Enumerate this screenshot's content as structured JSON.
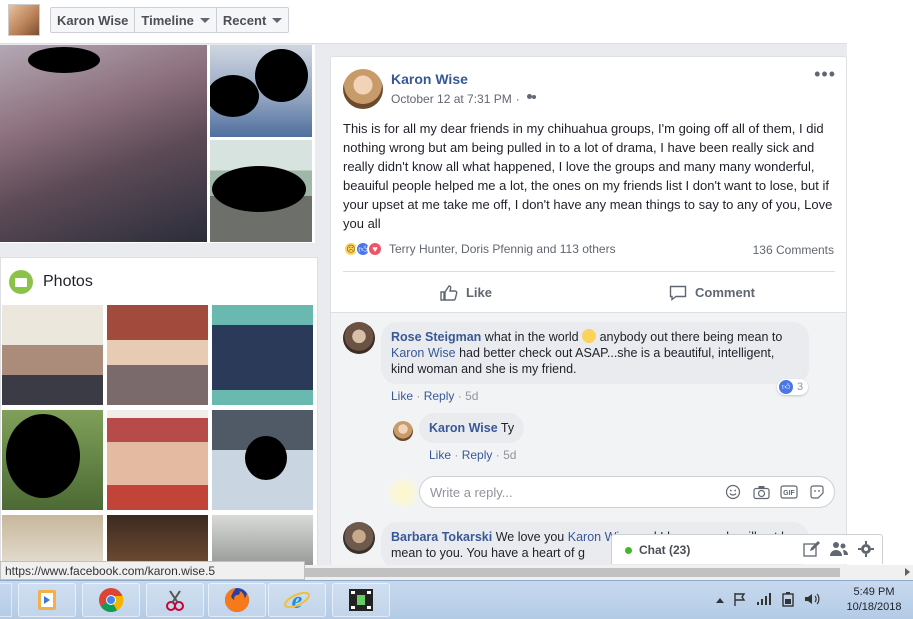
{
  "header": {
    "profile_name": "Karon Wise",
    "timeline_label": "Timeline",
    "recent_label": "Recent"
  },
  "photos": {
    "title": "Photos"
  },
  "post": {
    "author": "Karon Wise",
    "date": "October 12 at 7:31 PM",
    "separator": "·",
    "audience_icon": "friends-icon",
    "text": "This is for all my dear friends in my chihuahua groups, I'm going off all of them, I did nothing wrong but am being pulled in to a lot of drama, I have been really sick and really didn't know all what happened, I love the groups and many many wonderful, beauiful people helped me a lot, the ones on my friends list I don't want to lose, but if your upset at me take me off, I don't have any mean things to say to any of you, Love you all",
    "reactors": "Terry Hunter, Doris Pfennig and 113 others",
    "comments_count": "136 Comments",
    "like_label": "Like",
    "comment_label": "Comment"
  },
  "comments": [
    {
      "name": "Rose Steigman",
      "text_before": "what in the world",
      "text_after": "anybody out there being mean to",
      "mention": "Karon Wise",
      "text_end": "had better check out ASAP...she is a beautiful, intelligent, kind woman and she is my friend.",
      "like_label": "Like",
      "reply_label": "Reply",
      "age": "5d",
      "like_count": "3"
    },
    {
      "name": "Karon Wise",
      "text": "Ty",
      "like_label": "Like",
      "reply_label": "Reply",
      "age": "5d"
    },
    {
      "name": "Barbara Tokarski",
      "text_before": "We love you",
      "mention": "Karon Wise",
      "text_after": "and I hope people will not be mean to you. You have a heart of g"
    }
  ],
  "reply_box": {
    "placeholder": "Write a reply..."
  },
  "chat": {
    "label": "Chat (23)"
  },
  "status_bar": {
    "url": "https://www.facebook.com/karon.wise.5"
  },
  "taskbar": {
    "time": "5:49 PM",
    "date": "10/18/2018"
  },
  "colors": {
    "link_blue": "#365899",
    "online_green": "#42b72a",
    "like_blue": "#4a76e8"
  }
}
